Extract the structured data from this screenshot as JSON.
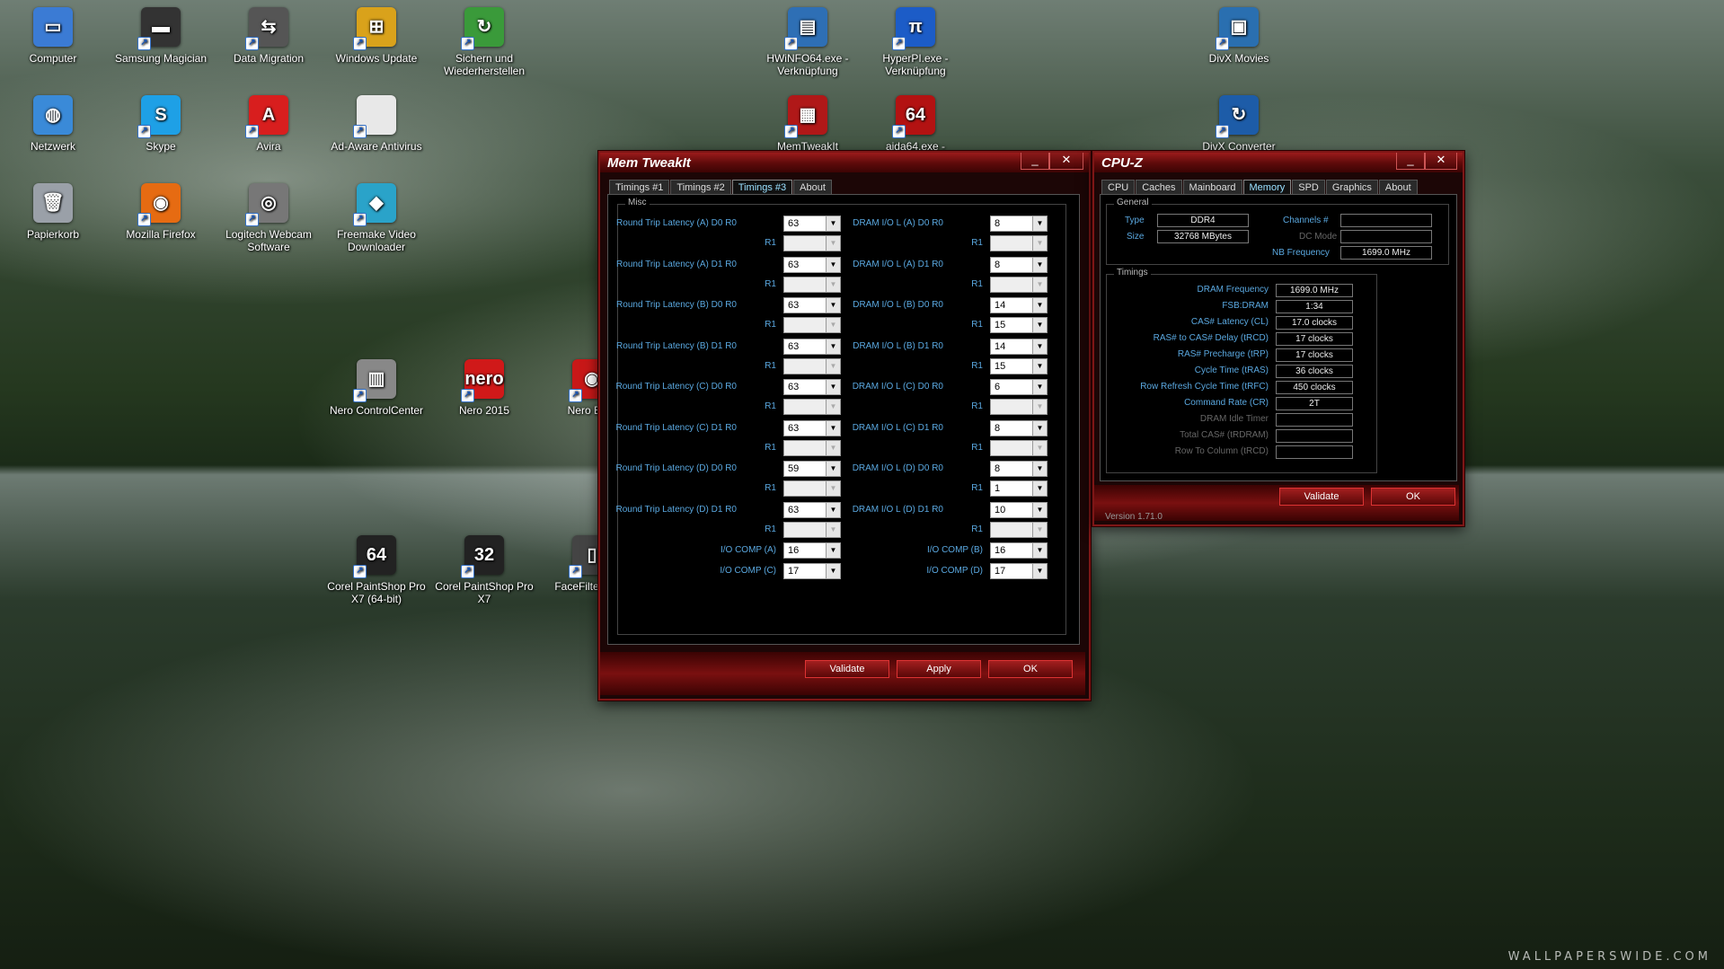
{
  "desktop": {
    "icons": [
      {
        "label": "Computer",
        "icon": "computer-icon",
        "color": "#3b7bd4",
        "glyph": "▭"
      },
      {
        "label": "Samsung Magician",
        "icon": "samsung-magician-icon",
        "color": "#333333",
        "glyph": "▬"
      },
      {
        "label": "Data Migration",
        "icon": "data-migration-icon",
        "color": "#555555",
        "glyph": "⇆"
      },
      {
        "label": "Windows Update",
        "icon": "windows-update-icon",
        "color": "#d9a21b",
        "glyph": "⊞"
      },
      {
        "label": "Sichern und Wiederherstellen",
        "icon": "backup-restore-icon",
        "color": "#3a9a3a",
        "glyph": "↻"
      },
      {
        "label": "HWiNFO64.exe - Verknüpfung",
        "icon": "hwinfo-icon",
        "color": "#2e6fb5",
        "glyph": "▤"
      },
      {
        "label": "HyperPI.exe - Verknüpfung",
        "icon": "hyperpi-icon",
        "color": "#1c5cc7",
        "glyph": "π"
      },
      {
        "label": "DivX Movies",
        "icon": "divx-movies-icon",
        "color": "#2a6fb0",
        "glyph": "▣"
      },
      {
        "label": "Netzwerk",
        "icon": "network-icon",
        "color": "#3a8ad8",
        "glyph": "◍"
      },
      {
        "label": "Skype",
        "icon": "skype-icon",
        "color": "#1ea0e6",
        "glyph": "S"
      },
      {
        "label": "Avira",
        "icon": "avira-icon",
        "color": "#d81e1e",
        "glyph": "A"
      },
      {
        "label": "Ad-Aware Antivirus",
        "icon": "file-icon",
        "color": "#e8e8e8",
        "glyph": ""
      },
      {
        "label": "MemTweakIt",
        "icon": "memtweakit-icon",
        "color": "#b01818",
        "glyph": "▦"
      },
      {
        "label": "aida64.exe -",
        "icon": "aida64-icon",
        "color": "#b31212",
        "glyph": "64"
      },
      {
        "label": "DivX Converter",
        "icon": "divx-converter-icon",
        "color": "#1d5ca8",
        "glyph": "↻"
      },
      {
        "label": "Papierkorb",
        "icon": "recycle-bin-icon",
        "color": "#9aa0a8",
        "glyph": "🗑"
      },
      {
        "label": "Mozilla Firefox",
        "icon": "firefox-icon",
        "color": "#e66b12",
        "glyph": "◉"
      },
      {
        "label": "Logitech Webcam Software",
        "icon": "webcam-icon",
        "color": "#777777",
        "glyph": "◎"
      },
      {
        "label": "Freemake Video Downloader",
        "icon": "freemake-icon",
        "color": "#2aa3c9",
        "glyph": "◆"
      },
      {
        "label": "Nero ControlCenter",
        "icon": "nero-controlcenter-icon",
        "color": "#888888",
        "glyph": "▥"
      },
      {
        "label": "Nero 2015",
        "icon": "nero-icon",
        "color": "#d01919",
        "glyph": "nero"
      },
      {
        "label": "Nero Burn",
        "icon": "nero-burn-icon",
        "color": "#c81818",
        "glyph": "◉"
      },
      {
        "label": "Corel PaintShop Pro X7 (64-bit)",
        "icon": "paintshop-64-icon",
        "color": "#222222",
        "glyph": "64"
      },
      {
        "label": "Corel PaintShop Pro X7",
        "icon": "paintshop-32-icon",
        "color": "#222222",
        "glyph": "32"
      },
      {
        "label": "FaceFilte Stanc",
        "icon": "facefilter-icon",
        "color": "#444444",
        "glyph": "▯"
      }
    ],
    "watermark": "WALLPAPERSWIDE.COM"
  },
  "memtweakit": {
    "title": "Mem TweakIt",
    "minimize": "_",
    "close": "✕",
    "tabs": [
      "Timings #1",
      "Timings #2",
      "Timings #3",
      "About"
    ],
    "active_tab": "Timings #3",
    "group": "Misc",
    "left_rows": [
      {
        "label": "Round Trip Latency (A)  D0   R0",
        "r0": "63",
        "r1_label": "R1",
        "r1": ""
      },
      {
        "label": "Round Trip Latency (A)  D1   R0",
        "r0": "63",
        "r1_label": "R1",
        "r1": ""
      },
      {
        "label": "Round Trip Latency (B)  D0   R0",
        "r0": "63",
        "r1_label": "R1",
        "r1": ""
      },
      {
        "label": "Round Trip Latency (B)  D1   R0",
        "r0": "63",
        "r1_label": "R1",
        "r1": ""
      },
      {
        "label": "Round Trip Latency (C)  D0   R0",
        "r0": "63",
        "r1_label": "R1",
        "r1": ""
      },
      {
        "label": "Round Trip Latency (C)  D1   R0",
        "r0": "63",
        "r1_label": "R1",
        "r1": ""
      },
      {
        "label": "Round Trip Latency (D)  D0   R0",
        "r0": "59",
        "r1_label": "R1",
        "r1": ""
      },
      {
        "label": "Round Trip Latency (D)  D1   R0",
        "r0": "63",
        "r1_label": "R1",
        "r1": ""
      }
    ],
    "right_rows": [
      {
        "label": "DRAM I/O L (A)  D0   R0",
        "r0": "8",
        "r1_label": "R1",
        "r1": ""
      },
      {
        "label": "DRAM I/O L (A)  D1   R0",
        "r0": "8",
        "r1_label": "R1",
        "r1": ""
      },
      {
        "label": "DRAM I/O L (B)  D0   R0",
        "r0": "14",
        "r1_label": "R1",
        "r1": "15"
      },
      {
        "label": "DRAM I/O L (B)  D1   R0",
        "r0": "14",
        "r1_label": "R1",
        "r1": "15"
      },
      {
        "label": "DRAM I/O L (C)  D0   R0",
        "r0": "6",
        "r1_label": "R1",
        "r1": ""
      },
      {
        "label": "DRAM I/O L (C)  D1   R0",
        "r0": "8",
        "r1_label": "R1",
        "r1": ""
      },
      {
        "label": "DRAM I/O L (D)  D0   R0",
        "r0": "8",
        "r1_label": "R1",
        "r1": "1"
      },
      {
        "label": "DRAM I/O L (D)  D1   R0",
        "r0": "10",
        "r1_label": "R1",
        "r1": ""
      }
    ],
    "comp_left": [
      {
        "label": "I/O COMP (A)",
        "value": "16"
      },
      {
        "label": "I/O COMP (C)",
        "value": "17"
      }
    ],
    "comp_right": [
      {
        "label": "I/O COMP (B)",
        "value": "16"
      },
      {
        "label": "I/O COMP (D)",
        "value": "17"
      }
    ],
    "buttons": {
      "validate": "Validate",
      "apply": "Apply",
      "ok": "OK"
    },
    "accent": "#7d1616"
  },
  "cpuz": {
    "title": "CPU-Z",
    "minimize": "_",
    "close": "✕",
    "tabs": [
      "CPU",
      "Caches",
      "Mainboard",
      "Memory",
      "SPD",
      "Graphics",
      "About"
    ],
    "active_tab": "Memory",
    "general": {
      "title": "General",
      "type_label": "Type",
      "type": "DDR4",
      "size_label": "Size",
      "size": "32768 MBytes",
      "channels_label": "Channels #",
      "channels": "",
      "dcmode_label": "DC Mode",
      "dcmode": "",
      "nbfreq_label": "NB Frequency",
      "nbfreq": "1699.0 MHz"
    },
    "timings_title": "Timings",
    "timings": [
      {
        "label": "DRAM Frequency",
        "value": "1699.0 MHz",
        "dim": false
      },
      {
        "label": "FSB:DRAM",
        "value": "1:34",
        "dim": false
      },
      {
        "label": "CAS# Latency (CL)",
        "value": "17.0 clocks",
        "dim": false
      },
      {
        "label": "RAS# to CAS# Delay (tRCD)",
        "value": "17 clocks",
        "dim": false
      },
      {
        "label": "RAS# Precharge (tRP)",
        "value": "17 clocks",
        "dim": false
      },
      {
        "label": "Cycle Time (tRAS)",
        "value": "36 clocks",
        "dim": false
      },
      {
        "label": "Row Refresh Cycle Time (tRFC)",
        "value": "450 clocks",
        "dim": false
      },
      {
        "label": "Command Rate (CR)",
        "value": "2T",
        "dim": false
      },
      {
        "label": "DRAM Idle Timer",
        "value": "",
        "dim": true
      },
      {
        "label": "Total CAS# (tRDRAM)",
        "value": "",
        "dim": true
      },
      {
        "label": "Row To Column (tRCD)",
        "value": "",
        "dim": true
      }
    ],
    "buttons": {
      "validate": "Validate",
      "ok": "OK"
    },
    "version": "Version 1.71.0"
  }
}
